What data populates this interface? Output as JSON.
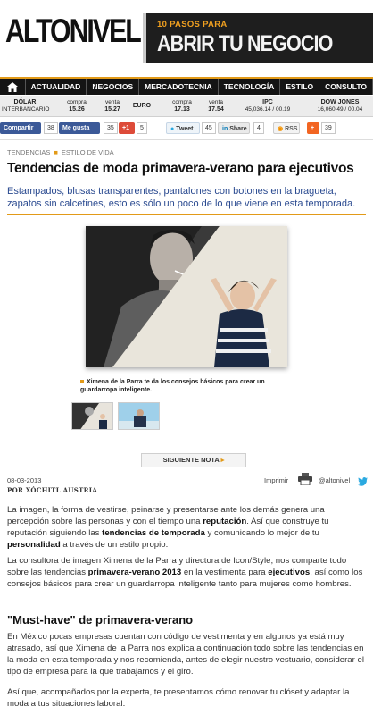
{
  "header": {
    "logo": "ALTONIVEL",
    "ad_small": "10 PASOS PARA",
    "ad_big": "ABRIR TU NEGOCIO"
  },
  "nav": [
    "ACTUALIDAD",
    "NEGOCIOS",
    "MERCADOTECNIA",
    "TECNOLOGÍA",
    "ESTILO",
    "CONSULTO"
  ],
  "ticker": {
    "dolar_label": "DÓLAR",
    "dolar_sub": "INTERBANCARIO",
    "compra1_label": "compra",
    "compra1_value": "15.26",
    "venta1_label": "venta",
    "venta1_value": "15.27",
    "euro_label": "EURO",
    "compra2_label": "compra",
    "compra2_value": "17.13",
    "venta2_label": "venta",
    "venta2_value": "17.54",
    "ipc_label": "IPC",
    "ipc_value": "45,036.14 / 00.19",
    "dow_label": "DOW JONES",
    "dow_value": "16,060.49 / 00.04"
  },
  "social": {
    "compartir": "Compartir",
    "compartir_count": "38",
    "megusta": "Me gusta",
    "megusta_count": "35",
    "gplus": "+1",
    "gplus_count": "5",
    "tweet": "Tweet",
    "tweet_count": "45",
    "share": "Share",
    "share_count": "4",
    "rss": "RSS",
    "plus_count": "39"
  },
  "breadcrumb": [
    "TENDENCIAS",
    "ESTILO DE VIDA"
  ],
  "article": {
    "title": "Tendencias de moda primavera-verano para ejecutivos",
    "lead": "Estampados, blusas transparentes, pantalones con botones en la bragueta, zapatos sin calcetines, esto es sólo un poco de lo que viene en esta temporada.",
    "caption": "Ximena de la Parra te da los consejos básicos para crear un guardarropa inteligente.",
    "next": "SIGUIENTE NOTA",
    "date": "08-03-2013",
    "author": "POR XÓCHITL AUSTRIA",
    "imprimir": "Imprimir",
    "handle": "@altonivel",
    "p1_a": "La imagen, la forma de vestirse, peinarse y presentarse ante los demás genera una percepción sobre las personas y con el tiempo una ",
    "p1_b": "reputación",
    "p1_c": ". Así que construye tu reputación siguiendo las ",
    "p1_d": "tendencias de temporada",
    "p1_e": " y comunicando lo mejor de tu ",
    "p1_f": "personalidad",
    "p1_g": " a través de un estilo propio.",
    "p2_a": "La consultora de imagen Ximena de la Parra y directora de Icon/Style, nos comparte todo sobre las tendencias ",
    "p2_b": "primavera-verano 2013",
    "p2_c": " en la vestimenta para ",
    "p2_d": "ejecutivos",
    "p2_e": ", así como los consejos básicos para crear un guardarropa inteligente tanto para mujeres como hombres.",
    "h2": "\"Must-have\" de primavera-verano",
    "p3": "En México pocas empresas cuentan con código de vestimenta y en algunos ya está muy atrasado, así que Ximena de la Parra nos explica a continuación todo sobre las tendencias en la moda en esta temporada y nos recomienda, antes de elegir nuestro vestuario, considerar el tipo de empresa para la que trabajamos y el giro.",
    "p4": "Así que, acompañados por la experta, te presentamos cómo renovar tu clóset y adaptar la moda a tus situaciones laboral."
  },
  "colors": {
    "accent": "#e29a18",
    "nav": "#141414",
    "lead": "#2a4a90"
  }
}
